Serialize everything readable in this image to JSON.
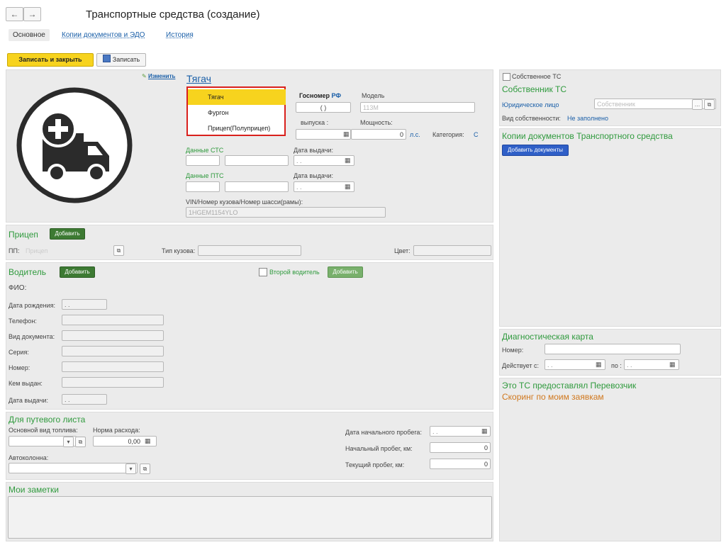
{
  "nav": {
    "back_icon": "←",
    "forward_icon": "→"
  },
  "page_title": "Транспортные средства (создание)",
  "tabs": [
    "Основное",
    "Копии документов и ЭДО",
    "История"
  ],
  "toolbar": {
    "save_close_label": "Записать и закрыть",
    "save_label": "Записать"
  },
  "vehicle": {
    "change_link": "Изменить",
    "type_link": "Тягач",
    "gosnomer_label": "Госномер",
    "gosnomer_suffix": "РФ",
    "gosnomer_value": "(  )",
    "model_label": "Модель",
    "model_placeholder": "113М",
    "year_label": "выпуска :",
    "power_label": "Мощность:",
    "power_value": "0",
    "power_unit": "л.с.",
    "category_label": "Категория:",
    "category_value": "С",
    "sts_label": "Данные СТС",
    "sts_date_label": "Дата выдачи:",
    "pts_label": "Данные ПТС",
    "pts_date_label": "Дата выдачи:",
    "date_placeholder": ". .",
    "vin_label": "VIN/Номер кузова/Номер шасси(рамы):",
    "vin_value": "1HGEM1154YLO"
  },
  "type_dropdown": {
    "items": [
      "Тягач",
      "Фургон",
      "Прицеп(Полуприцеп)"
    ],
    "selected_index": 0
  },
  "trailer": {
    "title": "Прицеп",
    "add_label": "Добавить",
    "pp_label": "ПП:",
    "pp_placeholder": "Прицеп",
    "body_type_label": "Тип кузова:",
    "color_label": "Цвет:"
  },
  "driver": {
    "title": "Водитель",
    "add_label": "Добавить",
    "second_driver_label": "Второй водитель",
    "second_add_label": "Добавить",
    "fio_label": "ФИО:",
    "birth_label": "Дата рождения:",
    "birth_value": ". .",
    "phone_label": "Телефон:",
    "doc_type_label": "Вид документа:",
    "series_label": "Серия:",
    "number_label": "Номер:",
    "issued_by_label": "Кем выдан:",
    "issue_date_label": "Дата выдачи:",
    "issue_date_value": ". ."
  },
  "waybill": {
    "title": "Для путевого листа",
    "fuel_label": "Основной вид топлива:",
    "rate_label": "Норма расхода:",
    "rate_value": "0,00",
    "column_label": "Автоколонна:",
    "start_date_label": "Дата начального пробега:",
    "start_date_value": ". .",
    "start_mileage_label": "Начальный пробег, км:",
    "start_mileage_value": "0",
    "current_mileage_label": "Текущий пробег, км:",
    "current_mileage_value": "0"
  },
  "notes": {
    "title": "Мои заметки"
  },
  "owner": {
    "own_vehicle_label": "Собственное ТС",
    "owner_title": "Собственник ТС",
    "legal_label": "Юридическое лицо",
    "owner_placeholder": "Собственник",
    "ownership_label": "Вид собственности:",
    "ownership_value": "Не заполнено"
  },
  "copies": {
    "title": "Копии документов Транспортного средства",
    "add_label": "Добавить документы"
  },
  "diag": {
    "title": "Диагностическая карта",
    "number_label": "Номер:",
    "valid_from_label": "Действует с:",
    "valid_from_value": ". .",
    "to_label": "по :",
    "to_value": ". ."
  },
  "carrier": {
    "provided_label": "Это ТС предоставлял Перевозчик",
    "scoring_label": "Скоринг по моим заявкам"
  },
  "colors": {
    "accent_yellow": "#f7d31e",
    "green": "#2f9a3d",
    "orange": "#d0781e",
    "link_blue": "#1a5fa8",
    "dropdown_border": "#d9201c"
  }
}
